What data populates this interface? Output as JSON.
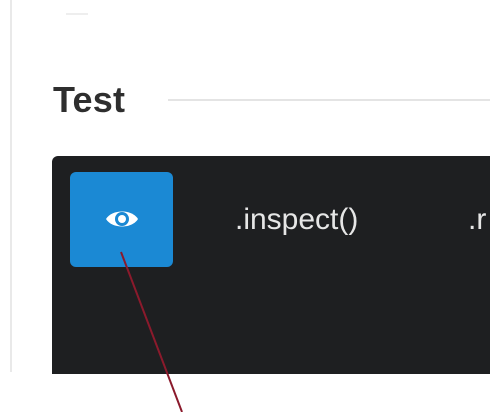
{
  "section": {
    "title": "Test"
  },
  "toolbar": {
    "eye_icon": "eye-icon",
    "inspect_label": ".inspect()",
    "next_label_partial": ".r"
  },
  "colors": {
    "toolbar_bg": "#1e1f21",
    "button_blue": "#1b89d4",
    "annotation_line": "#8b1a2c"
  }
}
